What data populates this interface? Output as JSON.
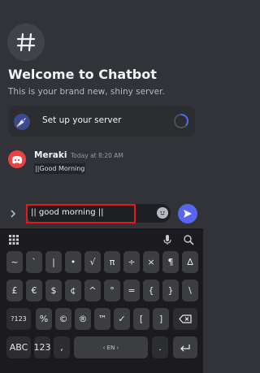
{
  "welcome": {
    "title": "Welcome to Chatbot",
    "subtitle": "This is your brand new, shiny server."
  },
  "setup": {
    "label": "Set up your server",
    "progress": 0.35
  },
  "message": {
    "author": "Meraki",
    "time": "Today at 8:20 AM",
    "text": "||Good Morning"
  },
  "composer": {
    "value": "|| good morning ||"
  },
  "keyboard": {
    "row1": [
      "~",
      "`",
      "|",
      "•",
      "√",
      "π",
      "÷",
      "×",
      "¶",
      "∆"
    ],
    "row2": [
      "£",
      "€",
      "$",
      "¢",
      "^",
      "°",
      "=",
      "{",
      "}",
      "\\"
    ],
    "row3": [
      "%",
      "©",
      "®",
      "™",
      "✓",
      "[",
      "]"
    ],
    "shift_label": "?123",
    "bottom": {
      "abc": "ABC",
      "num": "123",
      "comma": ",",
      "space": "EN",
      "period": "."
    }
  },
  "colors": {
    "background": "#313338",
    "accent": "#5865f2",
    "danger": "#ed4245",
    "highlight": "#e11a1a"
  }
}
